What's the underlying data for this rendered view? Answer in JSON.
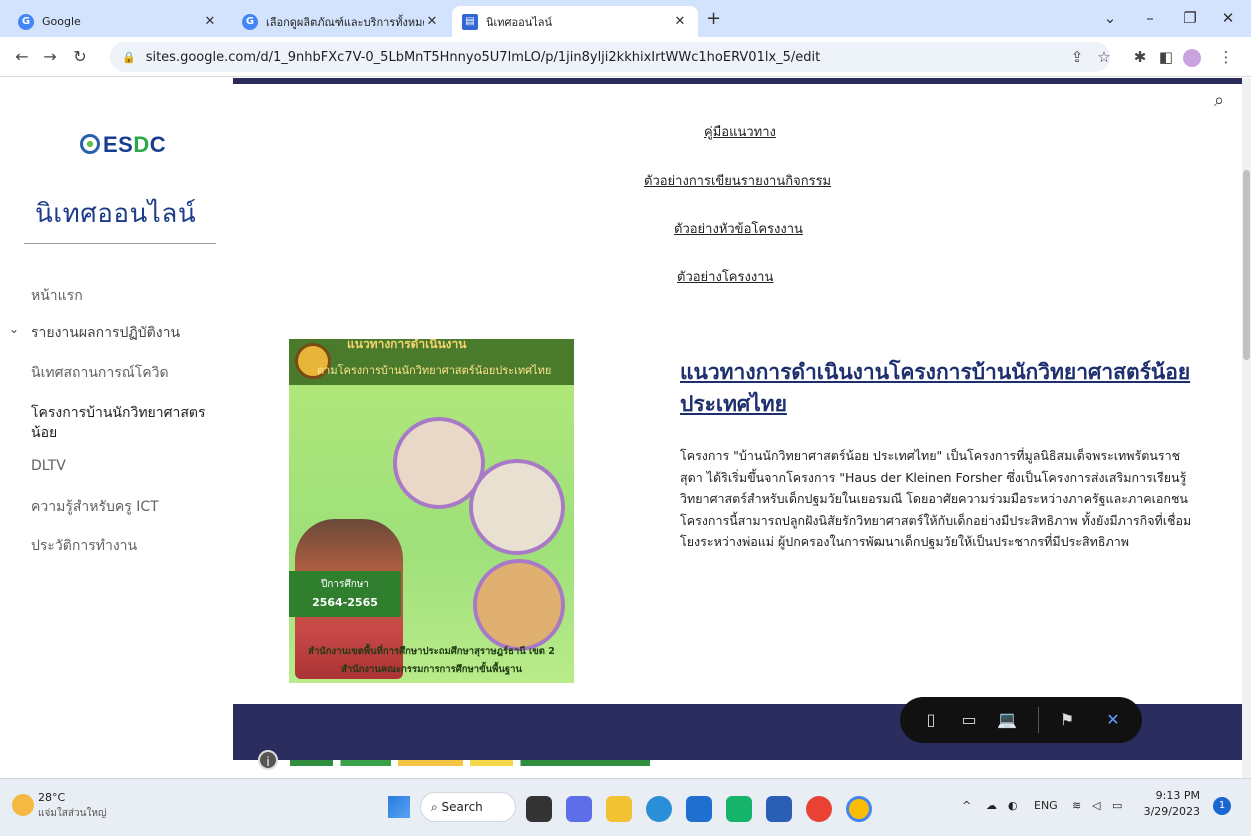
{
  "browser": {
    "tabs": [
      {
        "title": "Google",
        "icon": "google-icon",
        "color": "#4285f4"
      },
      {
        "title": "เลือกดูผลิตภัณฑ์และบริการทั้งหมดของ",
        "icon": "google-icon",
        "color": "#4285f4"
      },
      {
        "title": "นิเทศออนไลน์",
        "icon": "google-sites-icon",
        "color": "#3367d6"
      }
    ],
    "new_tab": "+",
    "url": "sites.google.com/d/1_9nhbFXc7V-0_5LbMnT5Hnnyo5U7lmLO/p/1jin8ylji2kkhixIrtWWc1hoERV01lx_5/edit"
  },
  "sidebar": {
    "logo_text_a": "ES",
    "logo_text_b": "D",
    "logo_text_c": "C",
    "site_title": "นิเทศออนไลน์",
    "items": [
      {
        "label": "หน้าแรก"
      },
      {
        "label": "รายงานผลการปฏิบัติงาน"
      },
      {
        "label": "นิเทศสถานการณ์โควิด"
      },
      {
        "label": "โครงการบ้านนักวิทยาศาสตร"
      },
      {
        "label": "น้อย"
      },
      {
        "label": "DLTV"
      },
      {
        "label": "ความรู้สำหรับครู ICT"
      },
      {
        "label": "ประวัติการทำงาน"
      }
    ],
    "expand_icon": "chevron-down-icon"
  },
  "main": {
    "links": [
      {
        "label": "คู่มือแนวทาง"
      },
      {
        "label": "ตัวอย่างการเขียนรายงานกิจกรรม"
      },
      {
        "label": "ตัวอย่างหัวข้อโครงงาน"
      },
      {
        "label": "ตัวอย่างโครงงาน"
      }
    ],
    "poster": {
      "head_line1": "แนวทางการดำเนินงาน",
      "head_line2": "ตามโครงการบ้านนักวิทยาศาสตร์น้อยประเทศไทย",
      "year_label": "ปีการศึกษา",
      "year": "2564-2565",
      "foot_line1": "สำนักงานเขตพื้นที่การศึกษาประถมศึกษาสุราษฎร์ธานี เขต 2",
      "foot_line2": "สำนักงานคณะกรรมการการศึกษาขั้นพื้นฐาน"
    },
    "heading": "แนวทางการดำเนินงานโครงการบ้านนักวิทยาศาสตร์น้อยประเทศไทย",
    "body": "โครงการ \"บ้านนักวิทยาศาสตร์น้อย ประเทศไทย\" เป็นโครงการที่มูลนิธิสมเด็จพระเทพรัตนราชสุดา ได้ริเริ่มขึ้นจากโครงการ \"Haus der Kleinen Forsher ซึ่งเป็นโครงการส่งเสริมการเรียนรู้วิทยาศาสตร์สำหรับเด็กปฐมวัยในเยอรมณี โดยอาศัยความร่วมมือระหว่างภาครัฐและภาคเอกชน โครงการนี้สามารถปลูกฝังนิสัยรักวิทยาศาสตร์ให้กับเด็กอย่างมีประสิทธิภาพ ทั้งยังมีภารกิจที่เชื่อมโยงระหว่างพ่อแม่ ผู้ปกครองในการพัฒนาเด็กปฐมวัยให้เป็นประชากรที่มีประสิทธิภาพ"
  },
  "taskbar": {
    "weather_temp": "28°C",
    "weather_text": "แจ่มใสส่วนใหญ่",
    "search_label": "Search",
    "lang": "ENG",
    "time": "9:13 PM",
    "date": "3/29/2023",
    "notif_count": "1"
  }
}
